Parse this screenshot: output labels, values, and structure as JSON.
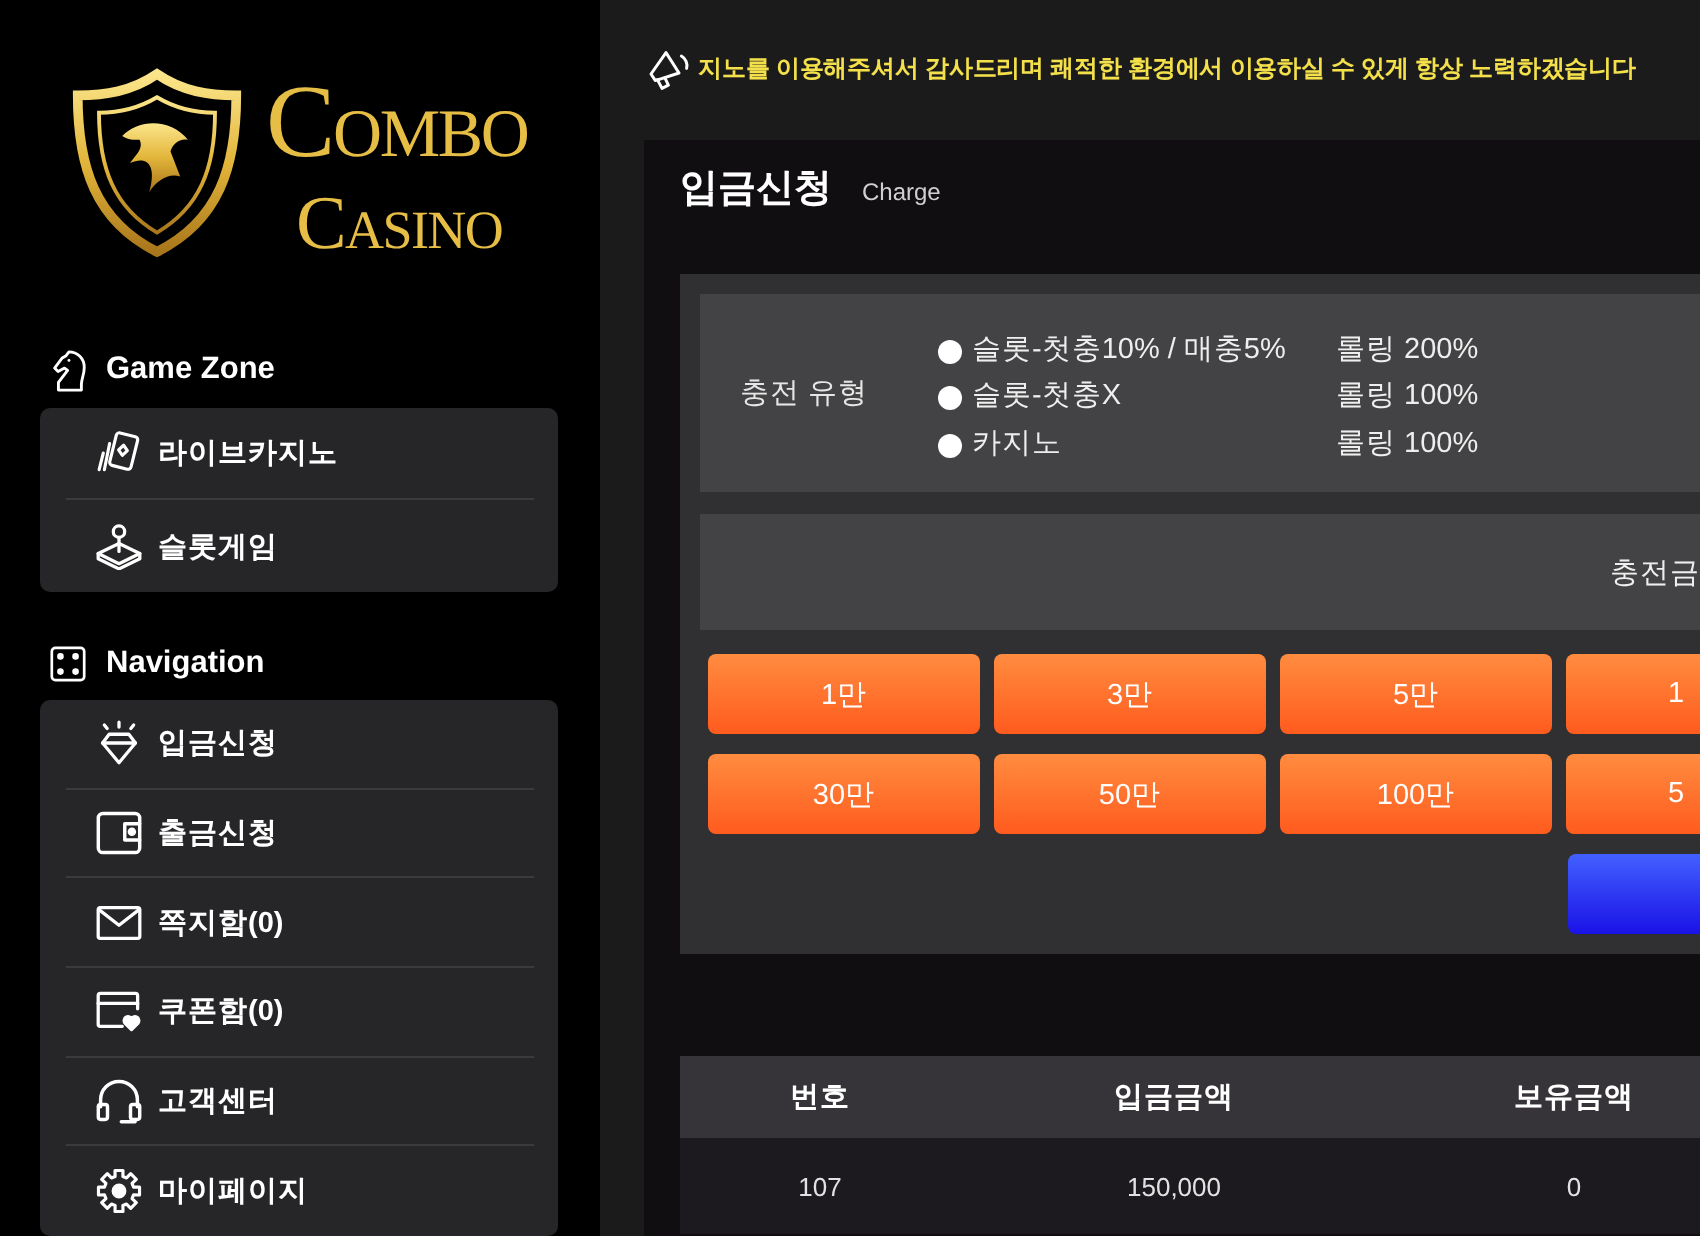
{
  "logo": {
    "line_1": "COMBO",
    "line_2": "CASINO"
  },
  "sidebar": [
    {
      "title": "Game Zone",
      "items": [
        "라이브카지노",
        "슬롯게임"
      ]
    },
    {
      "title": "Navigation",
      "items": [
        "입금신청",
        "출금신청",
        "쪽지함(0)",
        "쿠폰함(0)",
        "고객센터",
        "마이페이지"
      ]
    }
  ],
  "notice": {
    "text": "지노를 이용해주셔서 감사드리며 쾌적한 환경에서 이용하실 수 있게 항상 노력하겠습니다"
  },
  "page": {
    "title": "입금신청",
    "subtitle": "Charge"
  },
  "charge_type": {
    "label": "충전 유형",
    "options": [
      {
        "label": "슬롯-첫충10% / 매충5%",
        "rolling": "롤링 200%",
        "selected": false
      },
      {
        "label": "슬롯-첫충X",
        "rolling": "롤링 100%",
        "selected": false
      },
      {
        "label": "카지노",
        "rolling": "롤링 100%",
        "selected": false
      }
    ]
  },
  "amount": {
    "label": "충전금"
  },
  "quick_amounts": [
    "1만",
    "3만",
    "5만",
    "1",
    "30만",
    "50만",
    "100만",
    "5"
  ],
  "table": {
    "columns": [
      "번호",
      "입금금액",
      "보유금액"
    ],
    "rows": [
      [
        "107",
        "150,000",
        "0"
      ]
    ]
  }
}
